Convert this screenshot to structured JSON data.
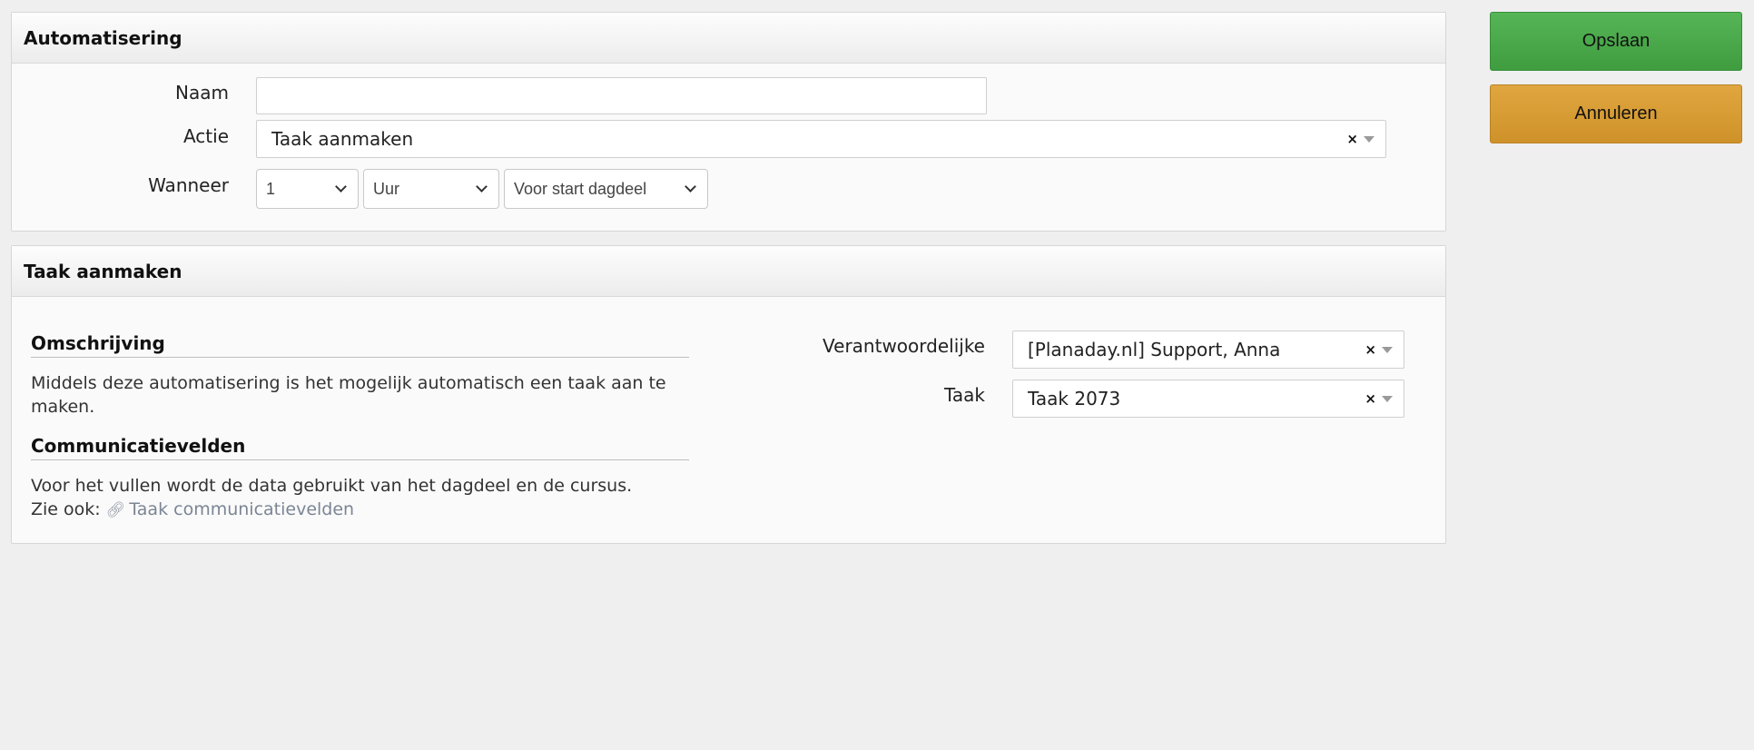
{
  "automatisering": {
    "title": "Automatisering",
    "naam_label": "Naam",
    "naam_value": "",
    "actie_label": "Actie",
    "actie_value": "Taak aanmaken",
    "wanneer_label": "Wanneer",
    "wanneer_amount": "1",
    "wanneer_unit": "Uur",
    "wanneer_moment": "Voor start dagdeel"
  },
  "taak": {
    "title": "Taak aanmaken",
    "omschrijving_title": "Omschrijving",
    "omschrijving_text": "Middels deze automatisering is het mogelijk automatisch een taak aan te maken.",
    "communicatie_title": "Communicatievelden",
    "communicatie_text": "Voor het vullen wordt de data gebruikt van het dagdeel en de cursus.",
    "zie_ook_label": "Zie ook:",
    "zie_ook_link": "Taak communicatievelden",
    "verantwoordelijke_label": "Verantwoordelijke",
    "verantwoordelijke_value": "[Planaday.nl] Support, Anna",
    "taak_label": "Taak",
    "taak_value": "Taak 2073"
  },
  "buttons": {
    "save": "Opslaan",
    "cancel": "Annuleren"
  },
  "icons": {
    "clear": "×",
    "link": "link-icon"
  },
  "colors": {
    "save": "#4caf50",
    "cancel": "#d89a33",
    "link": "#7b8594"
  }
}
